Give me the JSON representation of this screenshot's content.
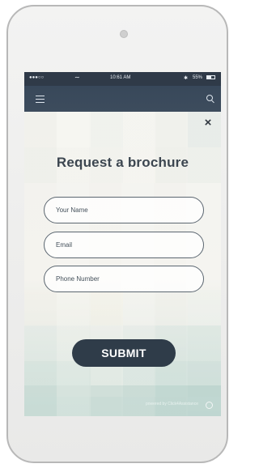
{
  "status": {
    "signal": "●●●○○",
    "wifi": "∼",
    "time": "10:61 AM",
    "bluetooth": "✱",
    "battery_pct": "55%",
    "battery_level": 0.55
  },
  "nav": {
    "menu_icon": "hamburger-icon",
    "search_icon": "search-icon"
  },
  "modal": {
    "close_label": "×",
    "title": "Request a brochure",
    "fields": [
      {
        "placeholder": "Your Name",
        "value": ""
      },
      {
        "placeholder": "Email",
        "value": ""
      },
      {
        "placeholder": "Phone Number",
        "value": ""
      }
    ],
    "submit_label": "SUBMIT",
    "powered_by": "powered by Click4Assistance"
  },
  "colors": {
    "nav_bg": "#38485a",
    "submit_bg": "#2f3c49",
    "title_text": "#3c4650"
  }
}
